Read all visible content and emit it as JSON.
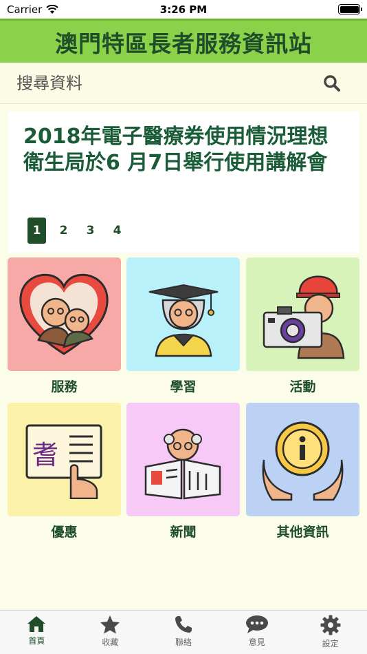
{
  "status_bar": {
    "carrier": "Carrier",
    "time": "3:26 PM"
  },
  "header": {
    "title": "澳門特區長者服務資訊站"
  },
  "search": {
    "placeholder": "搜尋資料",
    "icon": "search-icon"
  },
  "news": {
    "title": "2018年電子醫療券使用情況理想 衛生局於6 月7日舉行使用講解會",
    "pages": [
      "1",
      "2",
      "3",
      "4"
    ],
    "active_page": "1"
  },
  "tiles": [
    {
      "label": "服務",
      "bg": "#f7a9a8",
      "icon": "elderly-couple-heart-icon"
    },
    {
      "label": "學習",
      "bg": "#b9f1fb",
      "icon": "elderly-graduate-icon"
    },
    {
      "label": "活動",
      "bg": "#d8f3b9",
      "icon": "elderly-photographer-icon"
    },
    {
      "label": "優惠",
      "bg": "#fbf1a9",
      "icon": "senior-card-icon"
    },
    {
      "label": "新聞",
      "bg": "#f6c9f6",
      "icon": "elderly-reading-newspaper-icon"
    },
    {
      "label": "其他資訊",
      "bg": "#bcd2f5",
      "icon": "info-hands-icon"
    }
  ],
  "tab_bar": {
    "items": [
      {
        "label": "首頁",
        "icon": "home-icon"
      },
      {
        "label": "收藏",
        "icon": "star-icon"
      },
      {
        "label": "聯絡",
        "icon": "phone-icon"
      },
      {
        "label": "意見",
        "icon": "chat-bubble-icon"
      },
      {
        "label": "設定",
        "icon": "gear-icon"
      }
    ],
    "active": "首頁"
  },
  "colors": {
    "primary": "#1f4d2a",
    "header_bg": "#8bd24b",
    "page_bg": "#fbfde9"
  }
}
